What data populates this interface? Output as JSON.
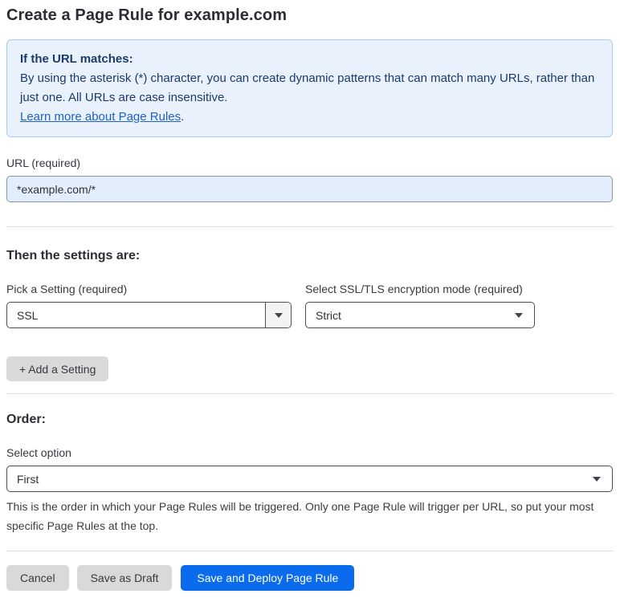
{
  "page": {
    "title": "Create a Page Rule for example.com"
  },
  "info_box": {
    "heading": "If the URL matches:",
    "body": "By using the asterisk (*) character, you can create dynamic patterns that can match many URLs, rather than just one. All URLs are case insensitive.",
    "link_label": "Learn more about Page Rules",
    "link_suffix": "."
  },
  "url_field": {
    "label": "URL (required)",
    "value": "*example.com/*"
  },
  "settings_section": {
    "heading": "Then the settings are:",
    "setting_select": {
      "label": "Pick a Setting (required)",
      "value": "SSL"
    },
    "mode_select": {
      "label": "Select SSL/TLS encryption mode (required)",
      "value": "Strict"
    },
    "add_setting_label": "+ Add a Setting"
  },
  "order_section": {
    "heading": "Order:",
    "select_label": "Select option",
    "select_value": "First",
    "help_text": "This is the order in which your Page Rules will be triggered. Only one Page Rule will trigger per URL, so put your most specific Page Rules at the top."
  },
  "actions": {
    "cancel_label": "Cancel",
    "save_draft_label": "Save as Draft",
    "save_deploy_label": "Save and Deploy Page Rule"
  },
  "colors": {
    "accent_blue": "#0a6cec",
    "info_background": "#e9f2fc",
    "info_border": "#abcbee",
    "info_text": "#1c3a69",
    "link_blue": "#1e5fcb",
    "input_background": "#e3eefc",
    "button_gray": "#d9d9d9"
  }
}
